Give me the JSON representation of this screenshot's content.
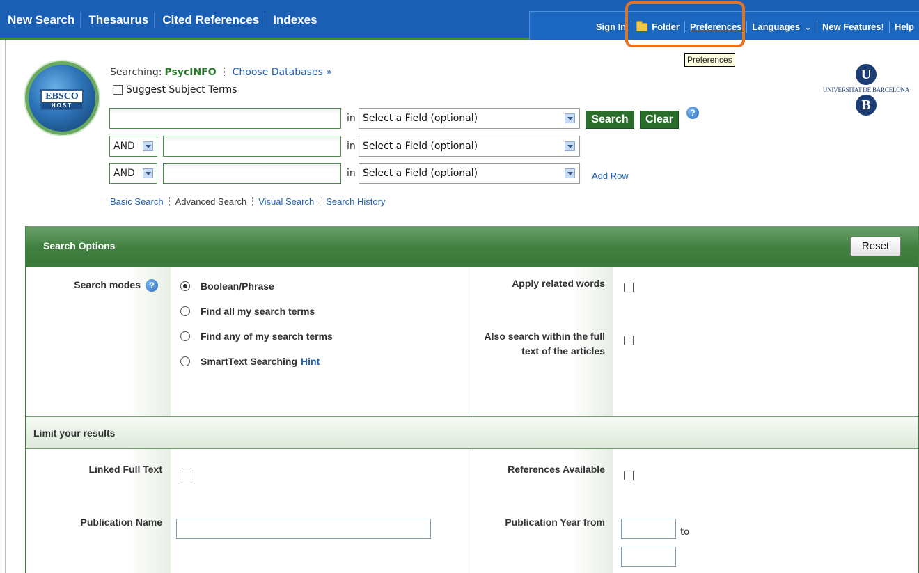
{
  "top_nav": [
    "New Search",
    "Thesaurus",
    "Cited References",
    "Indexes"
  ],
  "toolbar": {
    "sign_in": "Sign In",
    "folder": "Folder",
    "preferences": "Preferences",
    "languages": "Languages",
    "languages_chevron": "⌄",
    "new_features": "New Features!",
    "help": "Help"
  },
  "tooltip": "Preferences",
  "logo": {
    "top": "EBSCO",
    "bottom": "HOST"
  },
  "university": {
    "line_u": "U",
    "name": "UNIVERSITAT DE BARCELONA",
    "line_b": "B"
  },
  "search": {
    "searching_label": "Searching:",
    "database": "PsycINFO",
    "choose_databases": "Choose Databases »",
    "suggest_subject_terms": "Suggest Subject Terms",
    "in_label": "in",
    "rows": [
      {
        "bool": "",
        "query": "",
        "field": "Select a Field (optional)"
      },
      {
        "bool": "AND",
        "query": "",
        "field": "Select a Field (optional)"
      },
      {
        "bool": "AND",
        "query": "",
        "field": "Select a Field (optional)"
      }
    ],
    "search_button": "Search",
    "clear_button": "Clear",
    "help_glyph": "?",
    "add_row": "Add Row",
    "modes": [
      "Basic Search",
      "Advanced Search",
      "Visual Search",
      "Search History"
    ],
    "current_mode": "Advanced Search"
  },
  "search_options": {
    "title": "Search Options",
    "reset": "Reset",
    "search_modes_label": "Search modes",
    "modes": [
      {
        "label": "Boolean/Phrase",
        "selected": true
      },
      {
        "label": "Find all my search terms",
        "selected": false
      },
      {
        "label": "Find any of my search terms",
        "selected": false
      },
      {
        "label": "SmartText Searching",
        "selected": false,
        "hint": "Hint"
      }
    ],
    "apply_related_words": "Apply related words",
    "also_search_full_text": "Also search within the full text of the articles"
  },
  "limits": {
    "title": "Limit your results",
    "linked_full_text": "Linked Full Text",
    "references_available": "References Available",
    "publication_name": "Publication Name",
    "publication_name_value": "",
    "publication_year_from": "Publication Year from",
    "year_from_value": "",
    "to_label": "to",
    "year_to_value": ""
  },
  "colors": {
    "nav_blue": "#1a5fb4",
    "panel_green": "#3f7f3f",
    "highlight_orange": "#e37221"
  }
}
